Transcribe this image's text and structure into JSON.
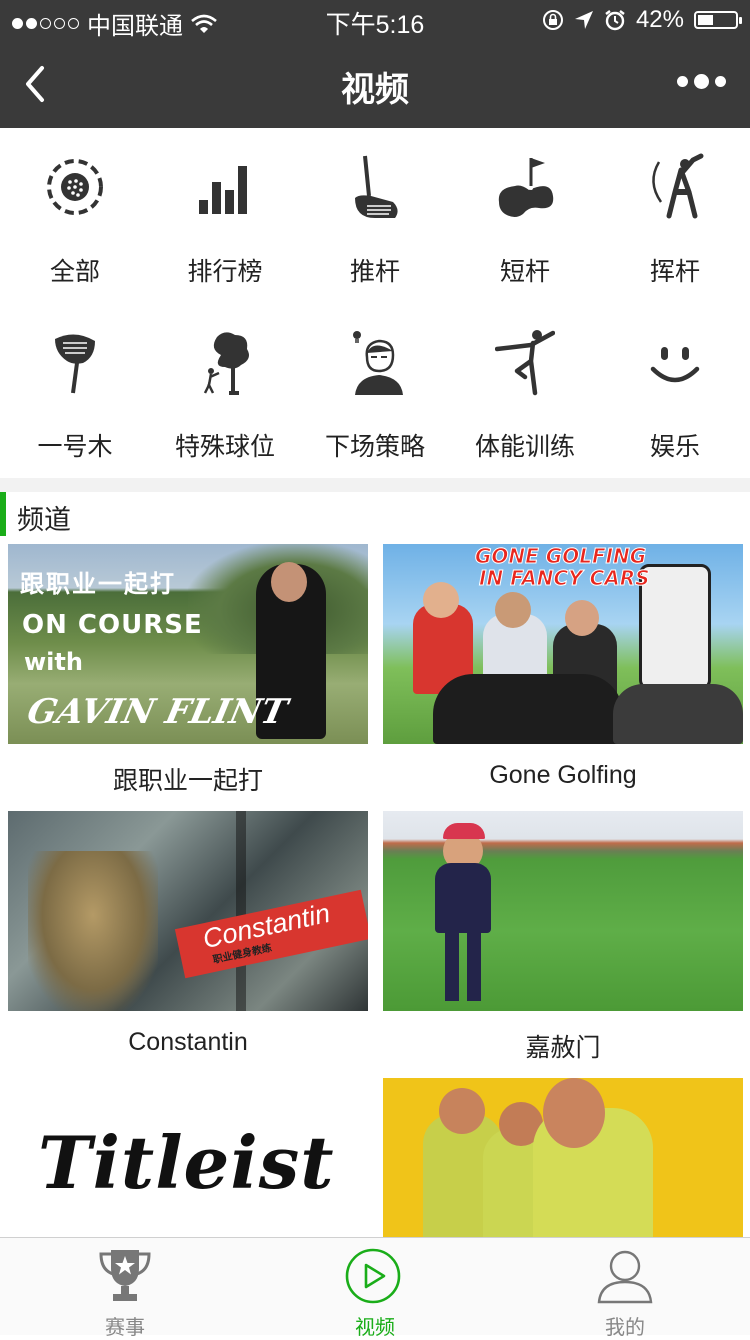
{
  "status_bar": {
    "carrier": "中国联通",
    "time": "下午5:16",
    "battery": "42%",
    "battery_level": 0.42
  },
  "nav": {
    "title": "视频"
  },
  "categories": [
    {
      "label": "全部",
      "icon": "golf-ball-icon"
    },
    {
      "label": "排行榜",
      "icon": "bar-chart-icon"
    },
    {
      "label": "推杆",
      "icon": "putter-icon"
    },
    {
      "label": "短杆",
      "icon": "green-flag-icon"
    },
    {
      "label": "挥杆",
      "icon": "golfer-swing-icon"
    },
    {
      "label": "一号木",
      "icon": "driver-club-icon"
    },
    {
      "label": "特殊球位",
      "icon": "tree-icon"
    },
    {
      "label": "下场策略",
      "icon": "thinking-person-icon"
    },
    {
      "label": "体能训练",
      "icon": "yoga-pose-icon"
    },
    {
      "label": "娱乐",
      "icon": "smile-icon"
    }
  ],
  "section": {
    "title": "频道"
  },
  "channels": [
    {
      "caption": "跟职业一起打",
      "thumb_line1": "跟职业一起打",
      "thumb_line2": "ON COURSE",
      "thumb_line3": "with",
      "thumb_line4": "GAVIN FLINT"
    },
    {
      "caption": "Gone Golfing",
      "thumb_line1": "GONE GOLFING",
      "thumb_line2": "IN FANCY CARS"
    },
    {
      "caption": "Constantin",
      "thumb_line1": "Constantin",
      "thumb_line2": "职业健身教练"
    },
    {
      "caption": "嘉赦门",
      "thumb_line1": ""
    },
    {
      "caption": "",
      "thumb_line1": "Titleist"
    },
    {
      "caption": "",
      "thumb_line1": ""
    }
  ],
  "tabs": [
    {
      "label": "赛事",
      "icon": "trophy-icon"
    },
    {
      "label": "视频",
      "icon": "play-circle-icon"
    },
    {
      "label": "我的",
      "icon": "user-icon"
    }
  ],
  "colors": {
    "accent": "#1aad19",
    "navbar": "#3a3a3a"
  }
}
